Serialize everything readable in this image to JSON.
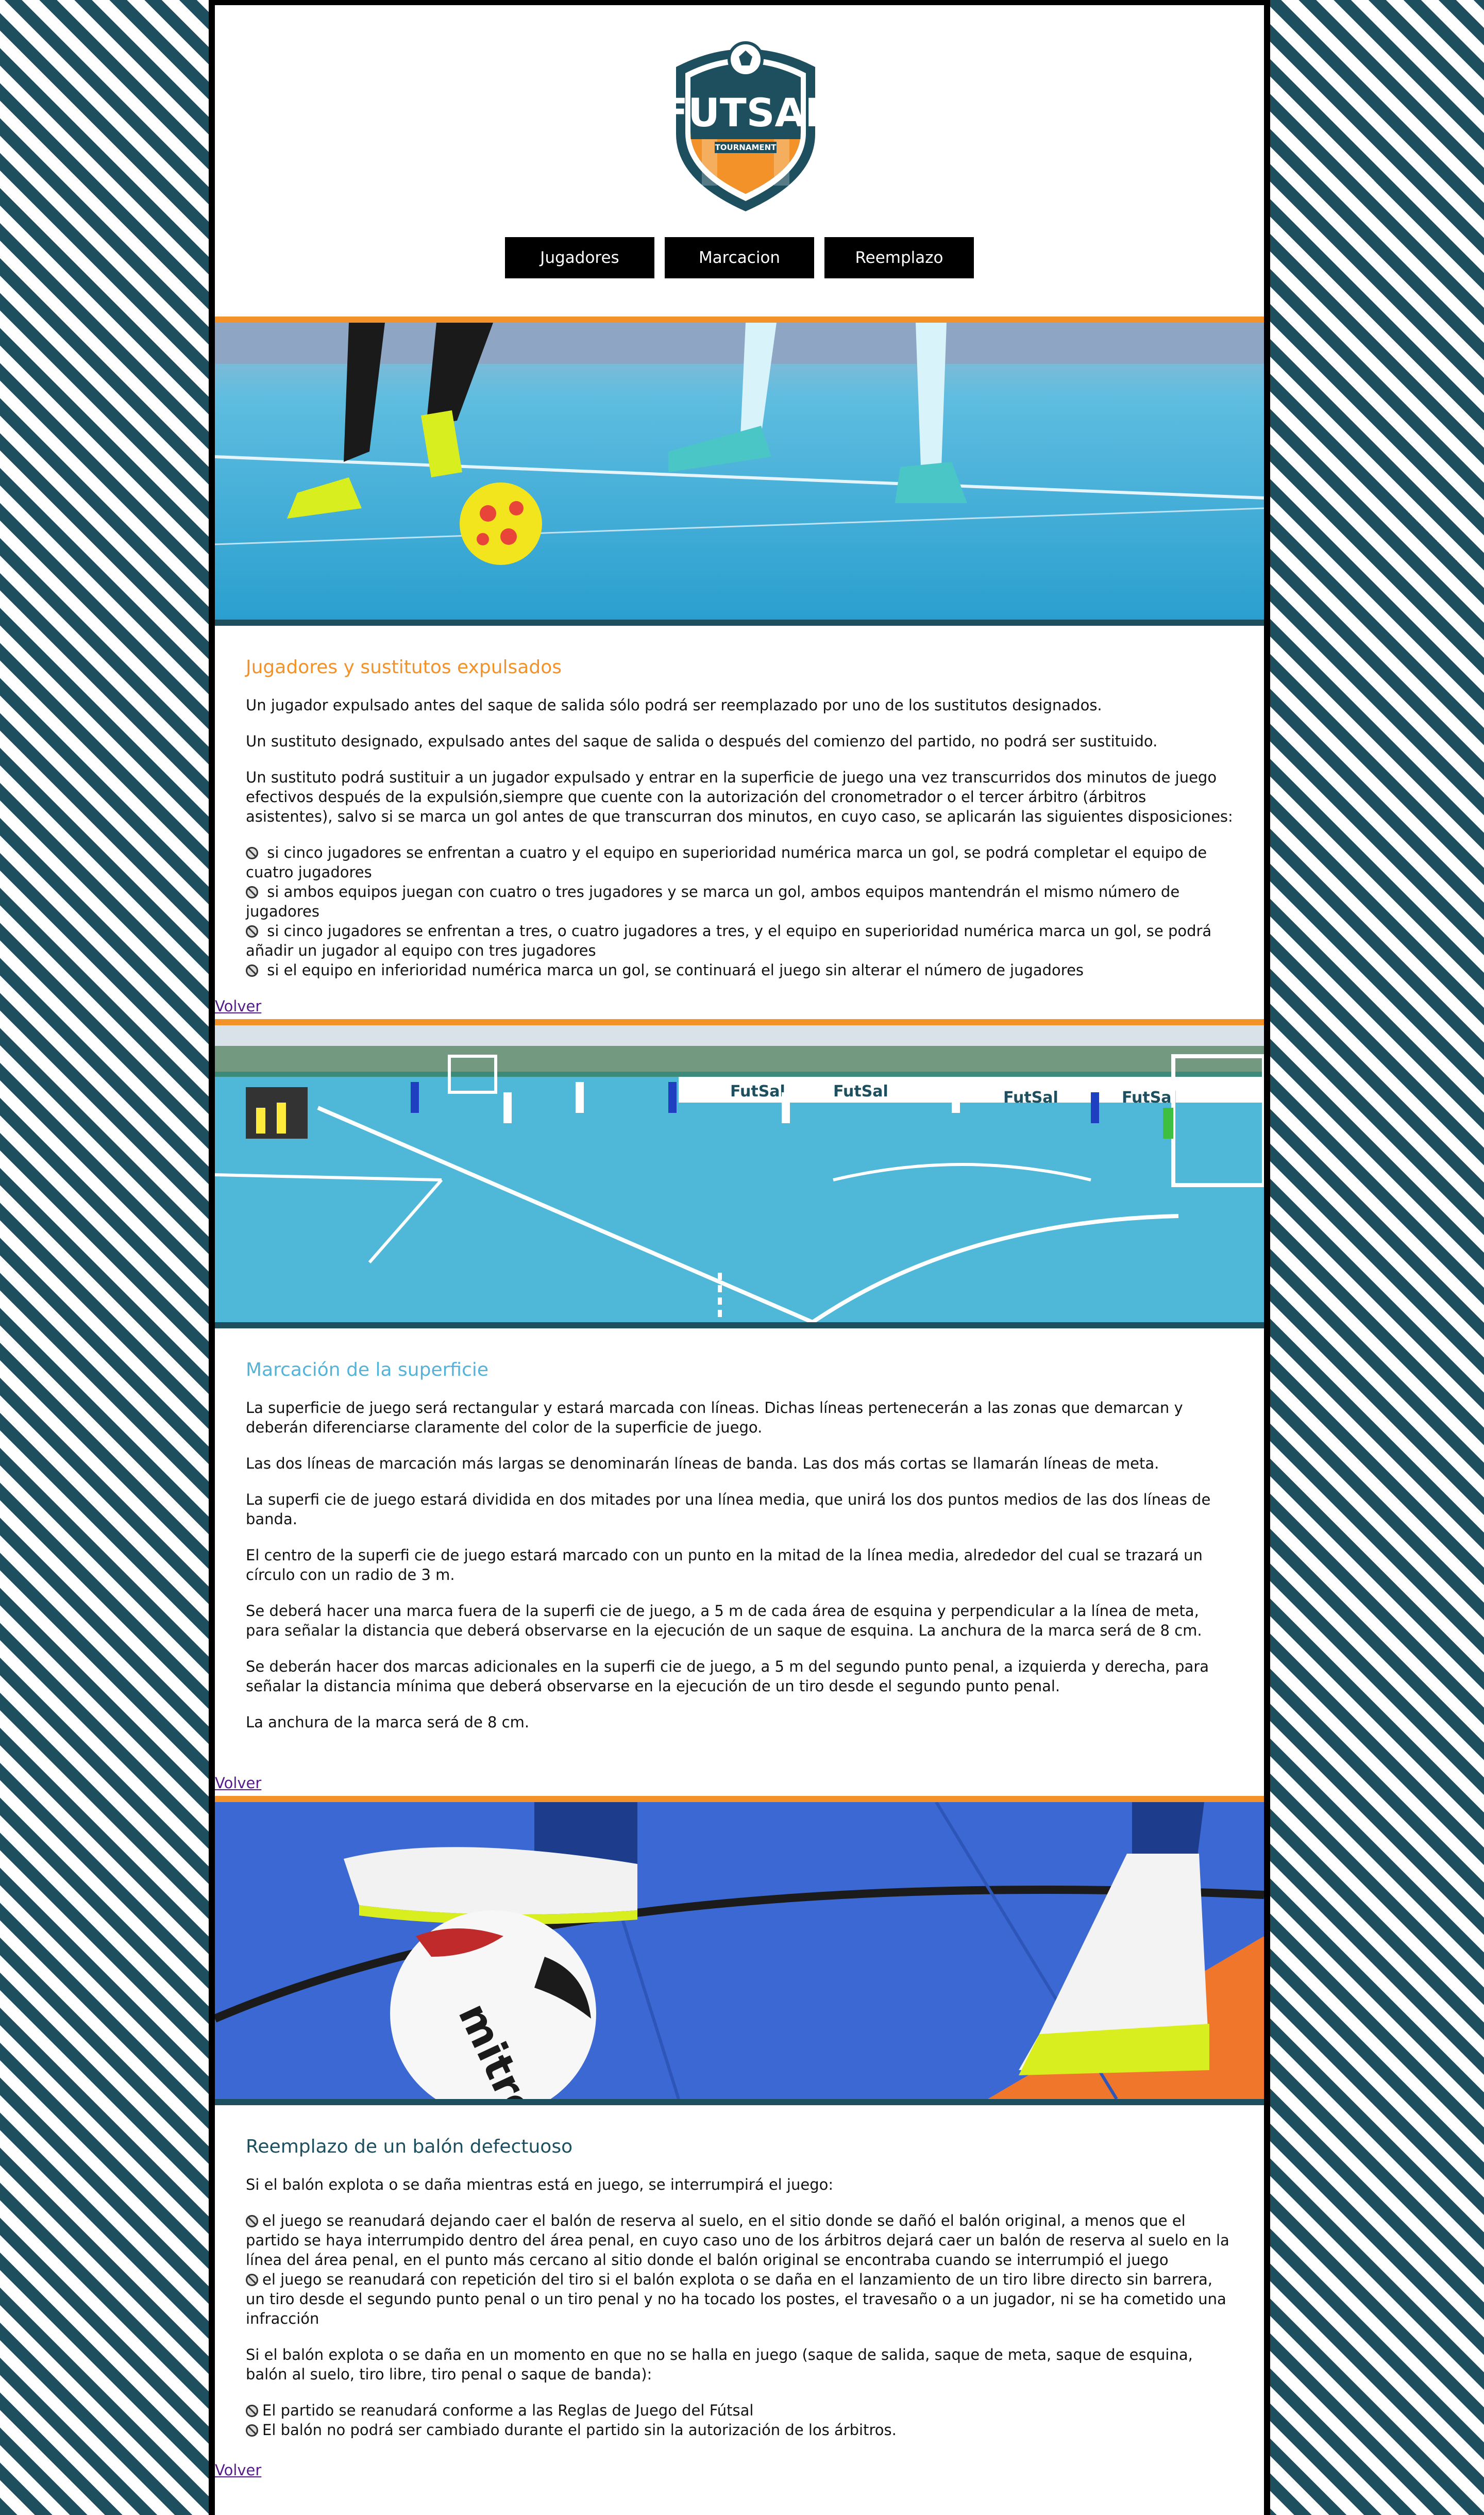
{
  "logo": {
    "main_text": "FUTSAL",
    "sub_text": "TOURNAMENT"
  },
  "nav": [
    "Jugadores",
    "Marcacion",
    "Reemplazo"
  ],
  "colors": {
    "teal": "#1e4f5e",
    "orange": "#f29228",
    "light_blue": "#55b3d9",
    "link": "#551a8b"
  },
  "sections": [
    {
      "title": "Jugadores y sustitutos expulsados",
      "title_color": "#f29228",
      "paragraphs": [
        "Un jugador expulsado antes del saque de salida sólo podrá ser reemplazado por uno de los sustitutos designados.",
        "Un sustituto designado, expulsado antes del saque de salida o después del comienzo del partido, no podrá ser sustituido.",
        "Un sustituto podrá sustituir a un jugador expulsado y entrar en la superficie de juego una vez transcurridos dos minutos de juego efectivos después de la expulsión,siempre que cuente con la autorización del cronometrador o el tercer árbitro (árbitros asistentes), salvo si se marca un gol antes de que transcurran dos minutos, en cuyo caso, se aplicarán las siguientes disposiciones:"
      ],
      "list": [
        " si cinco jugadores se enfrentan a cuatro y el equipo en superioridad numérica marca un gol, se podrá completar el equipo de cuatro jugadores",
        " si ambos equipos juegan con cuatro o tres jugadores y se marca un gol, ambos equipos mantendrán el mismo número de jugadores",
        " si cinco jugadores se enfrentan a tres, o cuatro jugadores a tres, y el equipo en superioridad numérica marca un gol, se podrá añadir un jugador al equipo con tres jugadores",
        " si el equipo en inferioridad numérica marca un gol, se continuará el juego sin alterar el número de jugadores"
      ],
      "volver": "Volver"
    },
    {
      "title": "Marcación de la superficie",
      "title_color": "#55b3d9",
      "paragraphs": [
        "La superficie de juego será rectangular y estará marcada con líneas. Dichas líneas pertenecerán a las zonas que demarcan y deberán diferenciarse claramente del color de la superficie de juego.",
        "Las dos líneas de marcación más largas se denominarán líneas de banda. Las dos más cortas se llamarán líneas de meta.",
        "La superfi cie de juego estará dividida en dos mitades por una línea media, que unirá los dos puntos medios de las dos líneas de banda.",
        "El centro de la superfi cie de juego estará marcado con un punto en la mitad de la línea media, alrededor del cual se trazará un círculo con un radio de 3 m.",
        "Se deberá hacer una marca fuera de la superfi cie de juego, a 5 m de cada área de esquina y perpendicular a la línea de meta, para señalar la distancia que deberá observarse en la ejecución de un saque de esquina. La anchura de la marca será de 8 cm.",
        "Se deberán hacer dos marcas adicionales en la superfi cie de juego, a 5 m del segundo punto penal, a izquierda y derecha, para señalar la distancia mínima que deberá observarse en la ejecución de un tiro desde el segundo punto penal.",
        "La anchura de la marca será de 8 cm."
      ],
      "list": [],
      "volver": "Volver"
    },
    {
      "title": "Reemplazo de un balón defectuoso",
      "title_color": "#1e4f5e",
      "paragraphs": [
        "Si el balón explota o se daña mientras está en juego, se interrumpirá el juego:"
      ],
      "list": [
        "el juego se reanudará dejando caer el balón de reserva al suelo, en el sitio donde se dañó el balón original, a menos que el partido se haya interrumpido dentro del área penal, en cuyo caso uno de los árbitros dejará caer un balón de reserva al suelo en la línea del área penal, en el punto más cercano al sitio donde el balón original se encontraba cuando se interrumpió el juego",
        "el juego se reanudará con repetición del tiro si el balón explota o se daña en el lanzamiento de un tiro libre directo sin barrera, un tiro desde el segundo punto penal o un tiro penal y no ha tocado los postes, el travesaño o a un jugador, ni se ha cometido una infracción"
      ],
      "paragraphs2": [
        "Si el balón explota o se daña en un momento en que no se halla en juego (saque de salida, saque de meta, saque de esquina, balón al suelo, tiro libre, tiro penal o saque de banda):"
      ],
      "list2": [
        "El partido se reanudará conforme a las Reglas de Juego del Fútsal",
        "El balón no podrá ser cambiado durante el partido sin la autorización de los árbitros."
      ],
      "volver": "Volver"
    }
  ],
  "banner_signs": [
    "FutSal",
    "FutSal",
    "FutSal",
    "FutSal"
  ],
  "ball_brand": "mitre"
}
